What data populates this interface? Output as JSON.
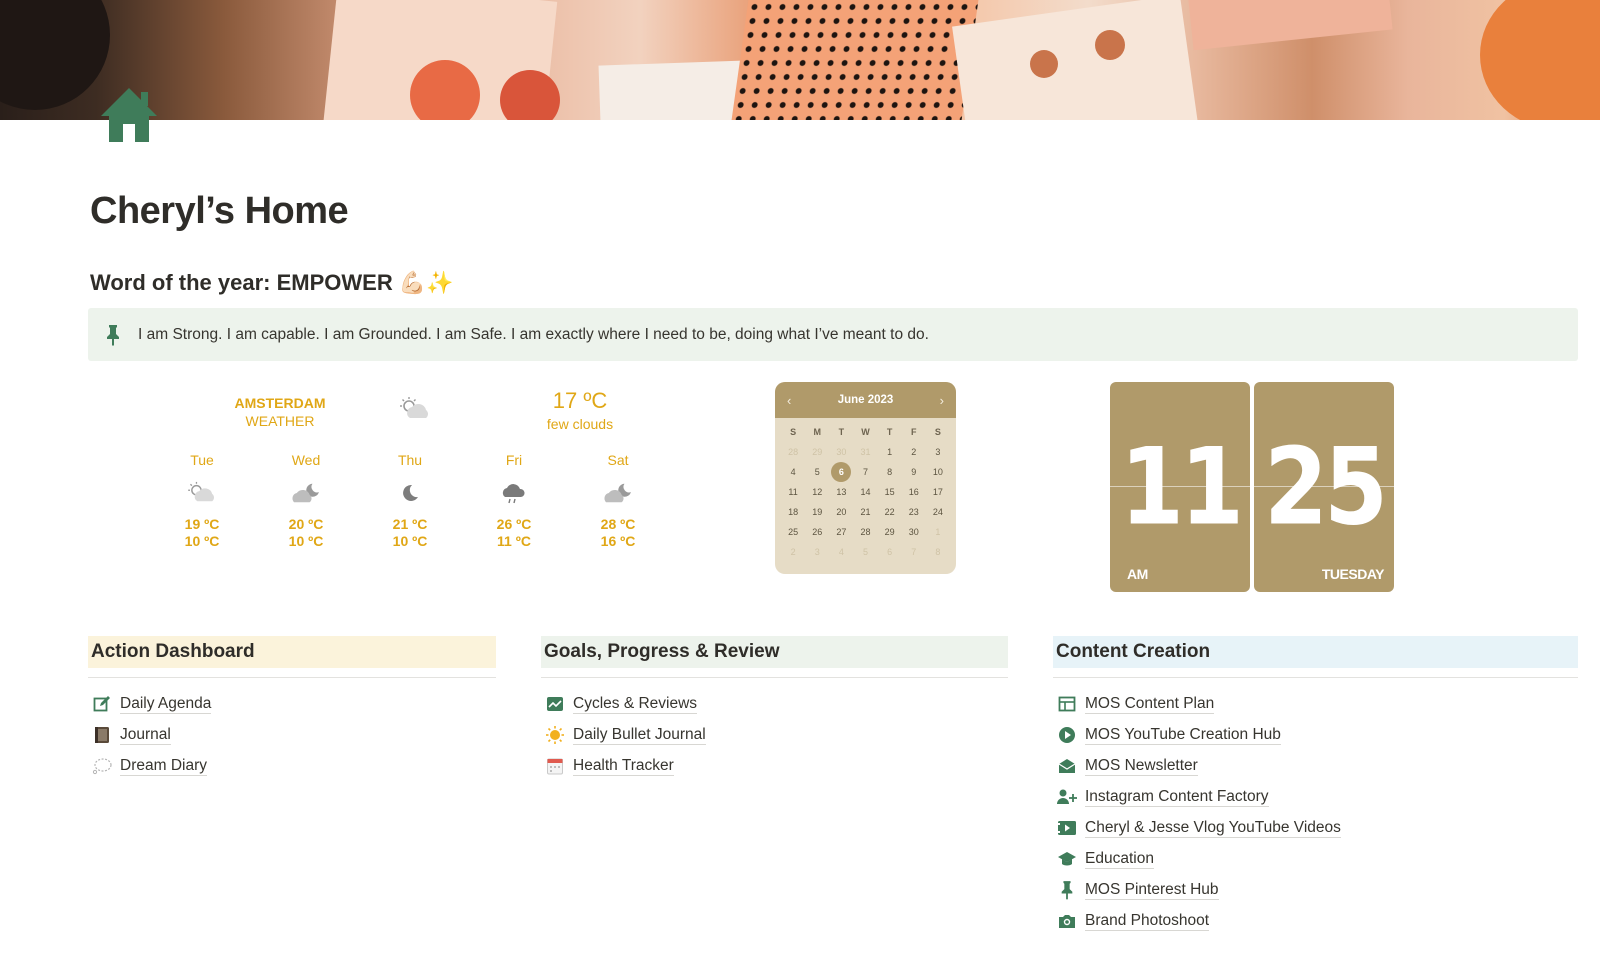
{
  "page": {
    "title": "Cheryl’s Home",
    "word_heading": "Word of the year: EMPOWER 💪🏻✨",
    "callout": "I am Strong. I am capable. I am Grounded. I am Safe. I am exactly where I need to be, doing what I’ve meant to do."
  },
  "icons": {
    "page_icon": "house-icon",
    "callout_icon": "pin-icon"
  },
  "colors": {
    "weather_text": "#e0a716",
    "widget_tan": "#b09a6a",
    "callout_bg": "#edf3ec",
    "icon_green": "#3f7c5a"
  },
  "weather": {
    "city": "AMSTERDAM",
    "label": "WEATHER",
    "current_temp": "17 ºC",
    "current_desc": "few clouds",
    "current_icon": "partly-cloudy-icon",
    "days": [
      {
        "name": "Tue",
        "high": "19 ºC",
        "low": "10 ºC",
        "icon": "partly-cloudy-icon"
      },
      {
        "name": "Wed",
        "high": "20 ºC",
        "low": "10 ºC",
        "icon": "cloudy-night-icon"
      },
      {
        "name": "Thu",
        "high": "21 ºC",
        "low": "10 ºC",
        "icon": "moon-icon"
      },
      {
        "name": "Fri",
        "high": "26 ºC",
        "low": "11 ºC",
        "icon": "rain-cloud-icon"
      },
      {
        "name": "Sat",
        "high": "28 ºC",
        "low": "16 ºC",
        "icon": "cloudy-night-icon"
      }
    ]
  },
  "calendar": {
    "month": "June 2023",
    "prev": "‹",
    "next": "›",
    "weekdays": [
      "S",
      "M",
      "T",
      "W",
      "T",
      "F",
      "S"
    ],
    "days": [
      {
        "d": "28",
        "m": true
      },
      {
        "d": "29",
        "m": true
      },
      {
        "d": "30",
        "m": true
      },
      {
        "d": "31",
        "m": true
      },
      {
        "d": "1"
      },
      {
        "d": "2"
      },
      {
        "d": "3"
      },
      {
        "d": "4"
      },
      {
        "d": "5"
      },
      {
        "d": "6",
        "today": true
      },
      {
        "d": "7"
      },
      {
        "d": "8"
      },
      {
        "d": "9"
      },
      {
        "d": "10"
      },
      {
        "d": "11"
      },
      {
        "d": "12"
      },
      {
        "d": "13"
      },
      {
        "d": "14"
      },
      {
        "d": "15"
      },
      {
        "d": "16"
      },
      {
        "d": "17"
      },
      {
        "d": "18"
      },
      {
        "d": "19"
      },
      {
        "d": "20"
      },
      {
        "d": "21"
      },
      {
        "d": "22"
      },
      {
        "d": "23"
      },
      {
        "d": "24"
      },
      {
        "d": "25"
      },
      {
        "d": "26"
      },
      {
        "d": "27"
      },
      {
        "d": "28"
      },
      {
        "d": "29"
      },
      {
        "d": "30"
      },
      {
        "d": "1",
        "m": true
      },
      {
        "d": "2",
        "m": true
      },
      {
        "d": "3",
        "m": true
      },
      {
        "d": "4",
        "m": true
      },
      {
        "d": "5",
        "m": true
      },
      {
        "d": "6",
        "m": true
      },
      {
        "d": "7",
        "m": true
      },
      {
        "d": "8",
        "m": true
      }
    ]
  },
  "clock": {
    "hour": "11",
    "minute": "25",
    "ampm": "AM",
    "weekday": "TUESDAY"
  },
  "columns": [
    {
      "heading": "Action Dashboard",
      "bg": "#fbf3db",
      "items": [
        {
          "label": "Daily Agenda",
          "icon": "edit-icon"
        },
        {
          "label": "Journal",
          "icon": "book-icon"
        },
        {
          "label": "Dream Diary",
          "icon": "thought-bubble-icon"
        }
      ]
    },
    {
      "heading": "Goals, Progress & Review",
      "bg": "#edf3ec",
      "items": [
        {
          "label": "Cycles & Reviews",
          "icon": "chart-icon"
        },
        {
          "label": "Daily Bullet Journal",
          "icon": "sun-icon"
        },
        {
          "label": "Health Tracker",
          "icon": "calendar-icon"
        }
      ]
    },
    {
      "heading": "Content Creation",
      "bg": "#e7f3f8",
      "items": [
        {
          "label": "MOS Content Plan",
          "icon": "table-icon"
        },
        {
          "label": "MOS YouTube Creation Hub",
          "icon": "play-icon"
        },
        {
          "label": "MOS Newsletter",
          "icon": "mail-icon"
        },
        {
          "label": "Instagram Content Factory",
          "icon": "add-user-icon"
        },
        {
          "label": "Cheryl & Jesse Vlog YouTube Videos",
          "icon": "video-icon"
        },
        {
          "label": "Education",
          "icon": "graduation-cap-icon"
        },
        {
          "label": "MOS Pinterest Hub",
          "icon": "pin-icon"
        },
        {
          "label": "Brand Photoshoot",
          "icon": "camera-icon"
        }
      ]
    }
  ]
}
